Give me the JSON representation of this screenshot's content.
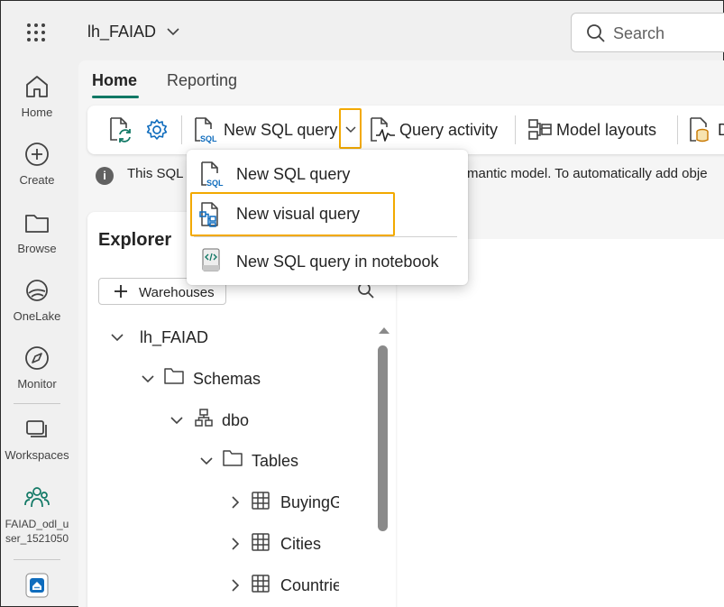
{
  "header": {
    "workspace_title": "lh_FAIAD",
    "search_placeholder": "Search"
  },
  "rail": [
    {
      "label": "Home",
      "icon": "home-icon"
    },
    {
      "label": "Create",
      "icon": "plus-circle-icon"
    },
    {
      "label": "Browse",
      "icon": "folder-icon"
    },
    {
      "label": "OneLake",
      "icon": "onelake-icon"
    },
    {
      "label": "Monitor",
      "icon": "monitor-compass-icon"
    },
    {
      "label": "Workspaces",
      "icon": "workspaces-icon"
    },
    {
      "label_line1": "FAIAD_odl_u",
      "label_line2": "ser_1521050",
      "icon": "people-icon"
    },
    {
      "icon": "lakehouse-app-icon"
    }
  ],
  "tabs": {
    "home": "Home",
    "reporting": "Reporting"
  },
  "toolbar": {
    "new_sql_query": "New SQL query",
    "query_activity": "Query activity",
    "model_layouts": "Model layouts",
    "partial_next": "D"
  },
  "infobar": {
    "text_left": "This SQL",
    "text_right": "mantic model. To automatically add obje"
  },
  "dropdown": {
    "items": [
      {
        "label": "New SQL query",
        "icon": "sql-file-icon"
      },
      {
        "label": "New visual query",
        "icon": "visual-query-icon",
        "highlighted": true
      },
      {
        "label": "New SQL query in notebook",
        "icon": "notebook-icon"
      }
    ]
  },
  "explorer": {
    "title": "Explorer",
    "add_button": "Warehouses",
    "tree": {
      "root": "lh_FAIAD",
      "schemas": "Schemas",
      "dbo": "dbo",
      "tables": "Tables",
      "items": [
        "BuyingGroups",
        "Cities",
        "Countries"
      ]
    }
  },
  "colors": {
    "accent_green": "#117865",
    "highlight_orange": "#f2a900",
    "icon_blue": "#0f6cbd"
  }
}
